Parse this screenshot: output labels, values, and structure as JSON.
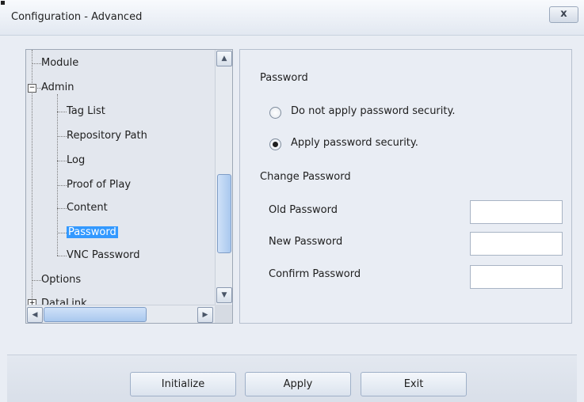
{
  "window": {
    "title": "Configuration - Advanced",
    "close_glyph": "x"
  },
  "tree": {
    "items": [
      {
        "label": "Module",
        "level": 1
      },
      {
        "label": "Admin",
        "level": 0,
        "expander": "−"
      },
      {
        "label": "Tag List",
        "level": 2
      },
      {
        "label": "Repository Path",
        "level": 2
      },
      {
        "label": "Log",
        "level": 2
      },
      {
        "label": "Proof of Play",
        "level": 2
      },
      {
        "label": "Content",
        "level": 2
      },
      {
        "label": "Password",
        "level": 2,
        "selected": true
      },
      {
        "label": "VNC Password",
        "level": 2
      },
      {
        "label": "Options",
        "level": 1
      },
      {
        "label": "DataLink",
        "level": 0,
        "expander": "+"
      }
    ],
    "scroll_up_glyph": "▲",
    "scroll_down_glyph": "▼",
    "scroll_left_glyph": "◀",
    "scroll_right_glyph": "▶"
  },
  "settings": {
    "password_heading": "Password",
    "radio_no_security": "Do not apply password security.",
    "radio_apply_security": "Apply password security.",
    "change_password_heading": "Change Password",
    "old_password_label": "Old Password",
    "new_password_label": "New Password",
    "confirm_password_label": "Confirm Password",
    "old_password_value": "",
    "new_password_value": "",
    "confirm_password_value": "",
    "selected_option": "apply"
  },
  "buttons": {
    "initialize": "Initialize",
    "apply": "Apply",
    "exit": "Exit"
  }
}
